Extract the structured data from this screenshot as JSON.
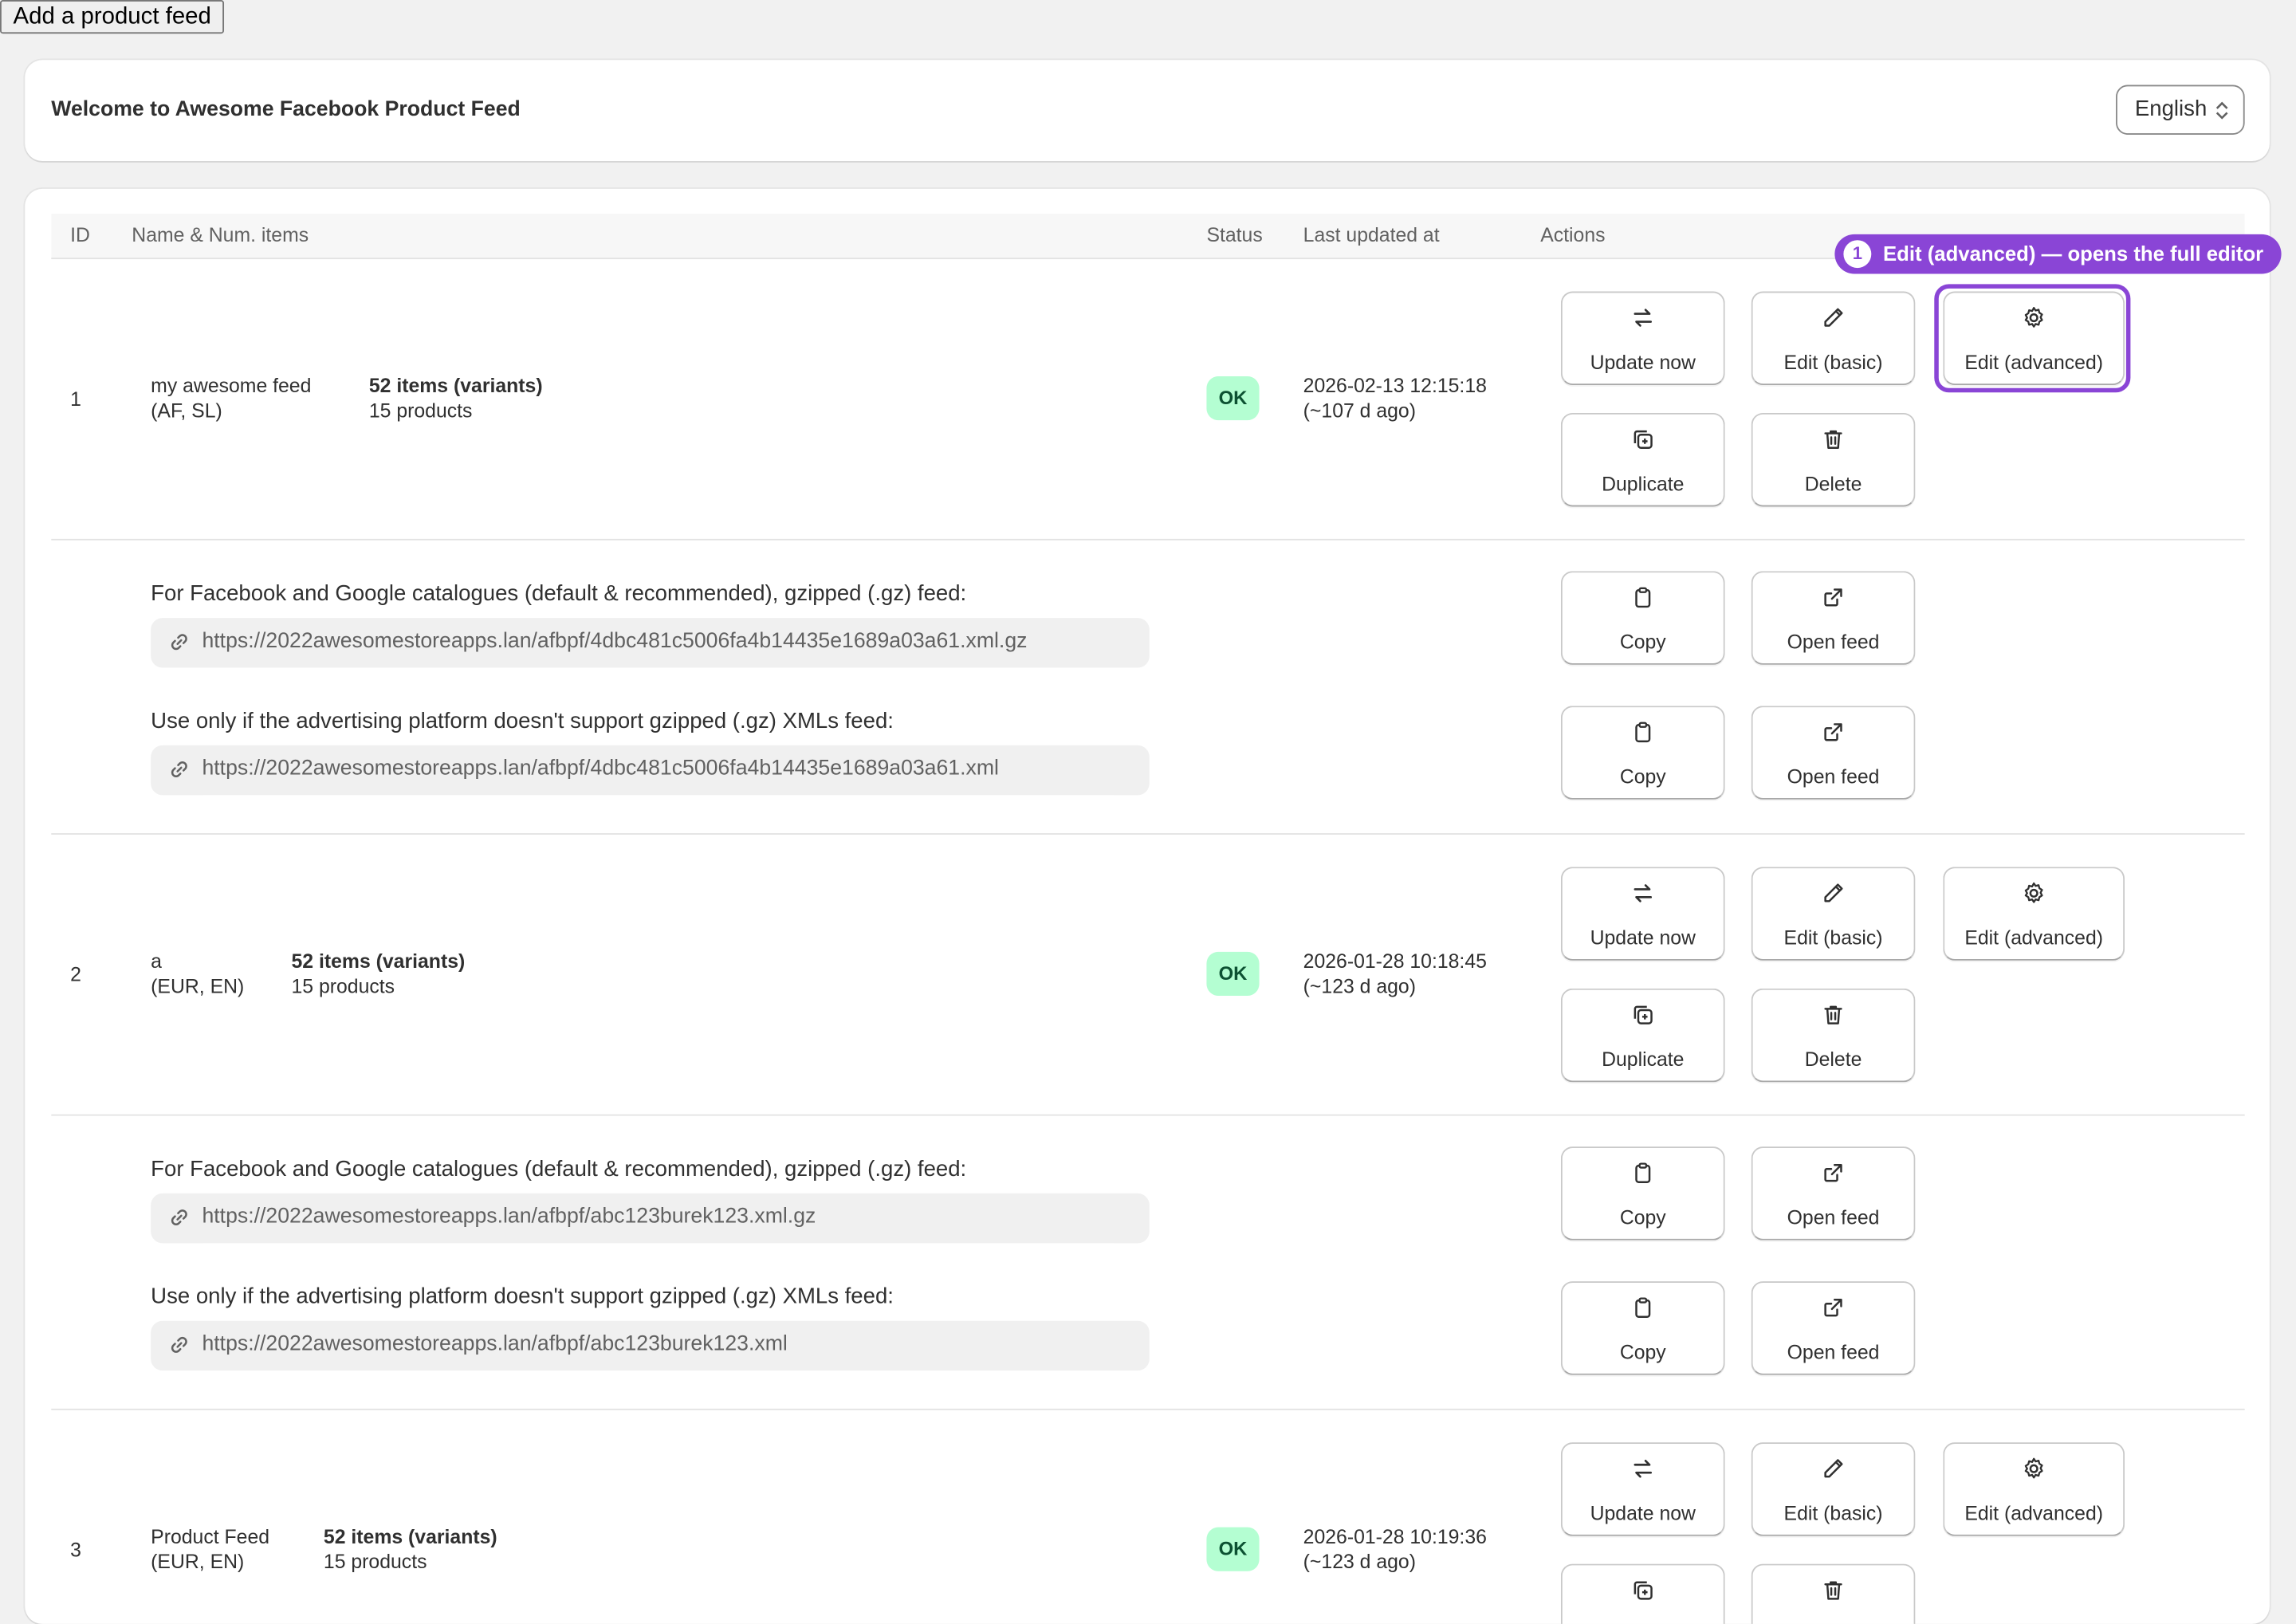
{
  "add_button_label": "Add a product feed",
  "welcome": {
    "title": "Welcome to Awesome Facebook Product Feed",
    "language": "English"
  },
  "table": {
    "headers": {
      "id": "ID",
      "name": "Name & Num. items",
      "status": "Status",
      "updated": "Last updated at",
      "actions": "Actions"
    }
  },
  "actions": {
    "update": "Update now",
    "edit_basic": "Edit (basic)",
    "edit_advanced": "Edit (advanced)",
    "duplicate": "Duplicate",
    "delete": "Delete",
    "copy": "Copy",
    "open_feed": "Open feed"
  },
  "feed_labels": {
    "gz": "For Facebook and Google catalogues (default & recommended), gzipped (.gz) feed:",
    "xml": "Use only if the advertising platform doesn't support gzipped (.gz) XMLs feed:"
  },
  "feeds": [
    {
      "id": "1",
      "name": "my awesome feed",
      "locale": "(AF, SL)",
      "items": "52 items (variants)",
      "products": "15 products",
      "status": "OK",
      "updated": "2026-02-13 12:15:18",
      "ago": "(~107 d ago)",
      "url_gz": "https://2022awesomestoreapps.lan/afbpf/4dbc481c5006fa4b14435e1689a03a61.xml.gz",
      "url_xml": "https://2022awesomestoreapps.lan/afbpf/4dbc481c5006fa4b14435e1689a03a61.xml"
    },
    {
      "id": "2",
      "name": "a",
      "locale": "(EUR, EN)",
      "items": "52 items (variants)",
      "products": "15 products",
      "status": "OK",
      "updated": "2026-01-28 10:18:45",
      "ago": "(~123 d ago)",
      "url_gz": "https://2022awesomestoreapps.lan/afbpf/abc123burek123.xml.gz",
      "url_xml": "https://2022awesomestoreapps.lan/afbpf/abc123burek123.xml"
    },
    {
      "id": "3",
      "name": "Product Feed",
      "locale": "(EUR, EN)",
      "items": "52 items (variants)",
      "products": "15 products",
      "status": "OK",
      "updated": "2026-01-28 10:19:36",
      "ago": "(~123 d ago)"
    }
  ],
  "callout": {
    "number": "1",
    "text": "Edit (advanced) — opens the full editor"
  },
  "colors": {
    "accent": "#8a45d6",
    "ok_bg": "#b4fed2",
    "ok_text": "#0c5132"
  }
}
